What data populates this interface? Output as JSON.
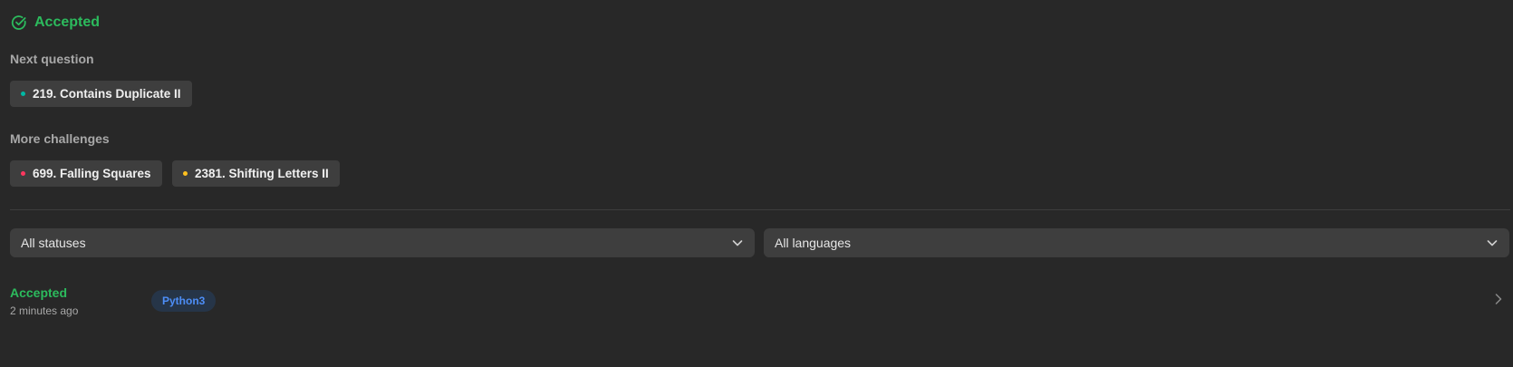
{
  "result": {
    "status": "Accepted",
    "icon": "check-circle-icon",
    "color": "#2cbb5d"
  },
  "next_question": {
    "label": "Next question",
    "items": [
      {
        "title": "219. Contains Duplicate II",
        "difficulty_color": "#00b8a3"
      }
    ]
  },
  "more_challenges": {
    "label": "More challenges",
    "items": [
      {
        "title": "699. Falling Squares",
        "difficulty_color": "#ff375f"
      },
      {
        "title": "2381. Shifting Letters II",
        "difficulty_color": "#ffc01e"
      }
    ]
  },
  "filters": {
    "status_select": {
      "value": "All statuses",
      "icon": "chevron-down-icon"
    },
    "language_select": {
      "value": "All languages",
      "icon": "chevron-down-icon"
    }
  },
  "submissions": [
    {
      "status": "Accepted",
      "time": "2 minutes ago",
      "language": "Python3",
      "icon": "chevron-right-icon"
    }
  ]
}
